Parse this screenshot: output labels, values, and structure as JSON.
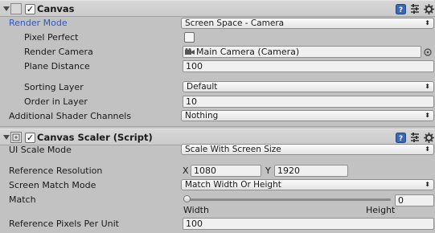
{
  "canvas": {
    "title": "Canvas",
    "enabled": true,
    "render_mode_label": "Render Mode",
    "render_mode_value": "Screen Space - Camera",
    "pixel_perfect_label": "Pixel Perfect",
    "pixel_perfect_checked": false,
    "render_camera_label": "Render Camera",
    "render_camera_value": "Main Camera (Camera)",
    "plane_distance_label": "Plane Distance",
    "plane_distance_value": "100",
    "sorting_layer_label": "Sorting Layer",
    "sorting_layer_value": "Default",
    "order_in_layer_label": "Order in Layer",
    "order_in_layer_value": "10",
    "shader_channels_label": "Additional Shader Channels",
    "shader_channels_value": "Nothing"
  },
  "scaler": {
    "title": "Canvas Scaler (Script)",
    "enabled": true,
    "ui_scale_mode_label": "UI Scale Mode",
    "ui_scale_mode_value": "Scale With Screen Size",
    "ref_resolution_label": "Reference Resolution",
    "x_label": "X",
    "x_value": "1080",
    "y_label": "Y",
    "y_value": "1920",
    "screen_match_label": "Screen Match Mode",
    "screen_match_value": "Match Width Or Height",
    "match_label": "Match",
    "match_value": "0",
    "match_fraction": 0,
    "width_label": "Width",
    "height_label": "Height",
    "ref_ppu_label": "Reference Pixels Per Unit",
    "ref_ppu_value": "100"
  },
  "icons": {
    "help": "help-book-icon",
    "presets": "presets-icon",
    "settings": "gear-icon",
    "object_picker": "object-picker-icon",
    "camera": "camera-icon"
  },
  "colors": {
    "background": "#c2c2c2",
    "accent_label": "#2b58c4"
  }
}
